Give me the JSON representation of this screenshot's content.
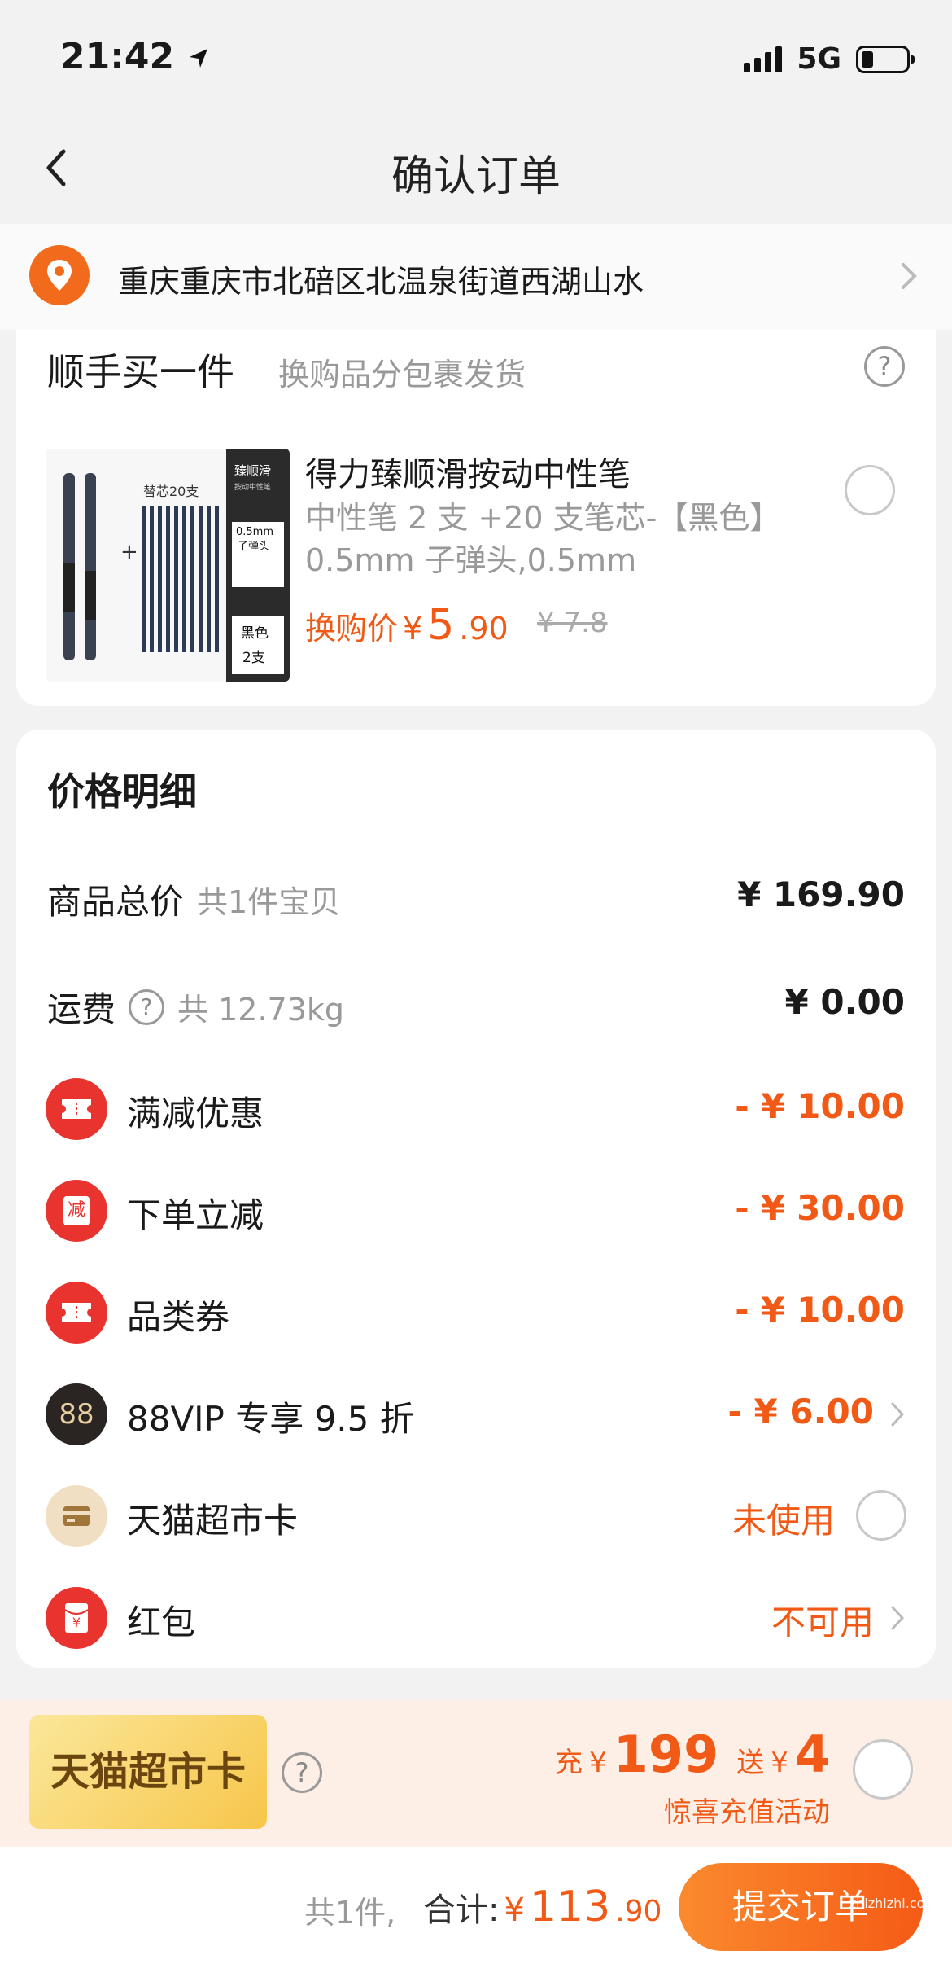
{
  "status_bar": {
    "time": "21:42",
    "network": "5G"
  },
  "nav": {
    "title": "确认订单"
  },
  "address": {
    "text": "重庆重庆市北碚区北温泉街道西湖山水"
  },
  "add_on": {
    "title": "顺手买一件",
    "subtitle": "换购品分包裹发货",
    "product_name": "得力臻顺滑按动中性笔",
    "product_desc": "中性笔 2 支 +20 支笔芯-【黑色】0.5mm 子弹头,0.5mm",
    "price_label": "换购价",
    "currency": "¥",
    "price_int": "5",
    "price_dec": ".90",
    "original_price": "¥ 7.8",
    "image_texts": {
      "refill": "替芯20支",
      "brand": "臻顺滑",
      "brand_sub": "按动中性笔",
      "tip": "0.5mm",
      "tip_sub": "子弹头",
      "color": "黑色",
      "count": "2支"
    }
  },
  "price_detail": {
    "title": "价格明细",
    "goods_label": "商品总价",
    "goods_sub": "共1件宝贝",
    "goods_value": "¥ 169.90",
    "shipping_label": "运费",
    "shipping_sub": "共 12.73kg",
    "shipping_value": "¥ 0.00",
    "discounts": [
      {
        "label": "满减优惠",
        "value": "- ¥ 10.00",
        "icon": "ticket-icon"
      },
      {
        "label": "下单立减",
        "value": "- ¥ 30.00",
        "icon": "reduce-badge-icon",
        "icon_text": "减"
      },
      {
        "label": "品类券",
        "value": "- ¥ 10.00",
        "icon": "ticket-icon"
      },
      {
        "label": "88VIP 专享 9.5 折",
        "value": "- ¥ 6.00",
        "icon": "vip-88-icon",
        "icon_text": "88"
      },
      {
        "label": "天猫超市卡",
        "value": "未使用",
        "icon": "card-icon"
      },
      {
        "label": "红包",
        "value": "不可用",
        "icon": "red-envelope-icon",
        "icon_text": "¥"
      }
    ]
  },
  "recharge": {
    "badge": "天猫超市卡",
    "recharge_prefix": "充",
    "recharge_currency": "¥",
    "recharge_amount": "199",
    "gift_prefix": "送",
    "gift_currency": "¥",
    "gift_amount": "4",
    "subtitle": "惊喜充值活动"
  },
  "footer": {
    "count": "共1件,",
    "total_label": "合计:",
    "currency": "¥",
    "total_int": "113",
    "total_dec": ".90",
    "submit_label": "提交订单",
    "watermark": "zhizhizhi.com"
  },
  "colors": {
    "accent": "#f05a16",
    "icon_red": "#e8332e"
  }
}
